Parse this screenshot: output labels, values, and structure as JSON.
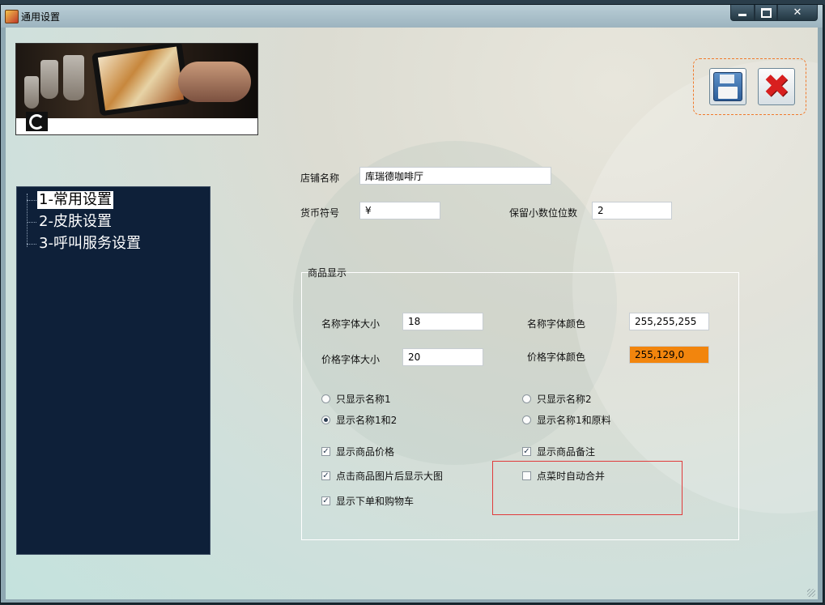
{
  "window": {
    "title": "通用设置",
    "controls": {
      "minimize": "–",
      "maximize": "□",
      "close": "✕"
    }
  },
  "toolbar": {
    "save_icon": "floppy-disk-icon",
    "close_icon": "red-x-icon"
  },
  "nav": {
    "items": [
      {
        "label": "1-常用设置",
        "selected": true
      },
      {
        "label": "2-皮肤设置",
        "selected": false
      },
      {
        "label": "3-呼叫服务设置",
        "selected": false
      }
    ]
  },
  "form": {
    "shop_name_label": "店铺名称",
    "shop_name_value": "库瑞德咖啡厅",
    "currency_label": "货币符号",
    "currency_value": "¥",
    "decimals_label": "保留小数位位数",
    "decimals_value": "2"
  },
  "product_display": {
    "title": "商品显示",
    "name_font_size_label": "名称字体大小",
    "name_font_size_value": "18",
    "price_font_size_label": "价格字体大小",
    "price_font_size_value": "20",
    "name_font_color_label": "名称字体颜色",
    "name_font_color_value": "255,255,255",
    "price_font_color_label": "价格字体颜色",
    "price_font_color_value": "255,129,0",
    "radios": [
      {
        "label": "只显示名称1",
        "checked": false
      },
      {
        "label": "只显示名称2",
        "checked": false
      },
      {
        "label": "显示名称1和2",
        "checked": true
      },
      {
        "label": "显示名称1和原料",
        "checked": false
      }
    ],
    "checkboxes": [
      {
        "label": "显示商品价格",
        "checked": true
      },
      {
        "label": "显示商品备注",
        "checked": true
      },
      {
        "label": "点击商品图片后显示大图",
        "checked": true
      },
      {
        "label": "点菜时自动合并",
        "checked": false
      },
      {
        "label": "显示下单和购物车",
        "checked": true
      }
    ]
  },
  "colors": {
    "nav_background": "#0e2039",
    "price_color_swatch": "#f2850d",
    "highlight_border": "#e03b3b",
    "toolbar_dashed_border": "#f07a2c"
  }
}
